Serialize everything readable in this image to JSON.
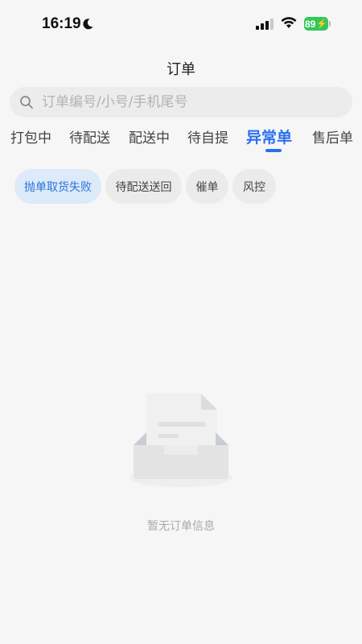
{
  "status_bar": {
    "time": "16:19",
    "battery": "89"
  },
  "header": {
    "title": "订单"
  },
  "search": {
    "placeholder": "订单编号/小号/手机尾号",
    "value": ""
  },
  "tabs": [
    {
      "label": "打包中",
      "active": false
    },
    {
      "label": "待配送",
      "active": false
    },
    {
      "label": "配送中",
      "active": false
    },
    {
      "label": "待自提",
      "active": false
    },
    {
      "label": "异常单",
      "active": true
    },
    {
      "label": "售后单",
      "active": false
    }
  ],
  "filters": [
    {
      "label": "抛单取货失败",
      "active": true
    },
    {
      "label": "待配送送回",
      "active": false
    },
    {
      "label": "催单",
      "active": false
    },
    {
      "label": "风控",
      "active": false
    }
  ],
  "empty_state": {
    "icon": "empty-inbox-icon",
    "message": "暂无订单信息"
  },
  "colors": {
    "accent": "#2b6ff3",
    "chip_active_bg": "#dceaf9",
    "chip_active_text": "#2b75d8",
    "battery": "#34c759"
  }
}
